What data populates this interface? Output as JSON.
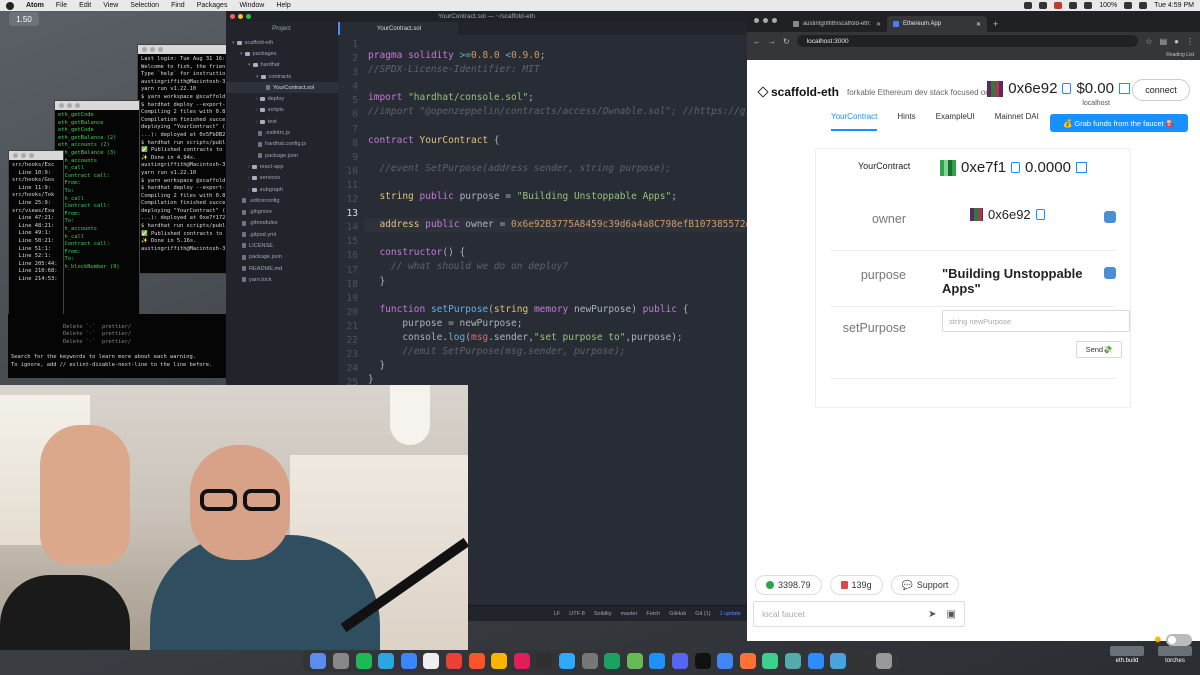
{
  "menubar": {
    "app": "Atom",
    "items": [
      "File",
      "Edit",
      "View",
      "Selection",
      "Find",
      "Packages",
      "Window",
      "Help"
    ],
    "battery": "100%",
    "clock": "Tue 4:59 PM"
  },
  "zoom_badge": "1.50",
  "terminals": {
    "t1": [
      "src/hooks/Exc",
      "  Line 10:9:",
      "",
      "src/hooks/Gos",
      "  Line 11:9:",
      "",
      "src/hooks/Tok",
      "  Line 25:9:",
      "",
      "src/views/Exa",
      "  Line 47:21:",
      "  Line 48:21:",
      "  Line 49:1:",
      "  Line 50:21:",
      "  Line 51:1:",
      "  Line 52:1:",
      "  Line 205:44:",
      "  Line 210:68:",
      "  Line 214:53:"
    ],
    "t2": [
      "eth_getCode",
      "eth_getBalance",
      "eth_getCode",
      "eth_getBalance (2)",
      "eth_accounts (2)",
      "eth_getBalance (3)",
      "eth_accounts",
      "eth_call",
      "  Contract call:",
      "  From:",
      "  To:",
      "",
      "eth_call",
      "  Contract call:",
      "  From:",
      "  To:",
      "",
      "eth_accounts",
      "eth_call",
      "  Contract call:",
      "  From:",
      "  To:",
      "",
      "eth_blockNumber (9)"
    ],
    "t3": [
      "Last login: Tue Aug 31 16:",
      "Welcome to fish, the frien",
      "Type `help` for instructio",
      "austingriffith@Macintosh-3",
      "yarn run v1.22.10",
      "$ yarn workspace @scaffold",
      "$ hardhat deploy --export-",
      "Compiling 2 files with 0.8",
      "Compilation finished succe",
      "deploying \"YourContract\" (",
      "...): deployed at 0x5FbDB2",
      "$ hardhat run scripts/publ",
      "✅ Published contracts to",
      "✨ Done in 4.94s.",
      "austingriffith@Macintosh-3",
      "yarn run v1.22.10",
      "$ yarn workspace @scaffold",
      "$ hardhat deploy --export-",
      "Compiling 2 files with 0.8",
      "Compilation finished succe",
      "deploying \"YourContract\" (",
      "...): deployed at 0xe7f172",
      "$ hardhat run scripts/publ",
      "✅ Published contracts to",
      "✨ Done in 5.16s.",
      "austingriffith@Macintosh-3"
    ],
    "main_lines": [
      "Delete `·`  prettier/",
      "Delete `·`  prettier/",
      "Delete `·`  prettier/"
    ],
    "footer1": "Search for the keywords to learn more about each warning.",
    "footer2": "To ignore, add // eslint-disable-next-line to the line before."
  },
  "atom": {
    "title": "YourContract.sol — ~/scaffold-eth",
    "project_tab": "Project",
    "file_tab": "YourContract.sol",
    "tree": [
      {
        "label": "scaffold-eth",
        "indent": 0,
        "type": "folder",
        "arrow": "▾"
      },
      {
        "label": "packages",
        "indent": 1,
        "type": "folder",
        "arrow": "▾"
      },
      {
        "label": "hardhat",
        "indent": 2,
        "type": "folder",
        "arrow": "▾"
      },
      {
        "label": "contracts",
        "indent": 3,
        "type": "folder",
        "arrow": "▾"
      },
      {
        "label": "YourContract.sol",
        "indent": 4,
        "type": "file",
        "arrow": "",
        "selected": true
      },
      {
        "label": "deploy",
        "indent": 3,
        "type": "folder",
        "arrow": "›"
      },
      {
        "label": "scripts",
        "indent": 3,
        "type": "folder",
        "arrow": "›"
      },
      {
        "label": "test",
        "indent": 3,
        "type": "folder",
        "arrow": "›"
      },
      {
        "label": ".eslintrc.js",
        "indent": 3,
        "type": "file",
        "arrow": ""
      },
      {
        "label": "hardhat.config.js",
        "indent": 3,
        "type": "file",
        "arrow": ""
      },
      {
        "label": "package.json",
        "indent": 3,
        "type": "file",
        "arrow": ""
      },
      {
        "label": "react-app",
        "indent": 2,
        "type": "folder",
        "arrow": "›"
      },
      {
        "label": "services",
        "indent": 2,
        "type": "folder",
        "arrow": "›"
      },
      {
        "label": "subgraph",
        "indent": 2,
        "type": "folder",
        "arrow": "›"
      },
      {
        "label": ".editorconfig",
        "indent": 1,
        "type": "file",
        "arrow": ""
      },
      {
        "label": ".gitignore",
        "indent": 1,
        "type": "file",
        "arrow": ""
      },
      {
        "label": ".gitmodules",
        "indent": 1,
        "type": "file",
        "arrow": ""
      },
      {
        "label": ".gitpod.yml",
        "indent": 1,
        "type": "file",
        "arrow": ""
      },
      {
        "label": "LICENSE",
        "indent": 1,
        "type": "file",
        "arrow": ""
      },
      {
        "label": "package.json",
        "indent": 1,
        "type": "file",
        "arrow": ""
      },
      {
        "label": "README.md",
        "indent": 1,
        "type": "file",
        "arrow": ""
      },
      {
        "label": "yarn.lock",
        "indent": 1,
        "type": "file",
        "arrow": ""
      }
    ],
    "current_line": 13,
    "status": [
      "LF",
      "UTF-8",
      "Solidity",
      "master",
      "Fetch",
      "GitHub",
      "Git (1)",
      "1 update"
    ]
  },
  "browser": {
    "tabs": [
      {
        "label": "austintgriffith/scaffold-eth: f",
        "active": false
      },
      {
        "label": "Ethereum App",
        "active": true
      }
    ],
    "url": "localhost:3000",
    "bookmarks": "Reading List",
    "app": {
      "logo": "scaffold-eth",
      "tagline": "forkable Ethereum dev stack focused on fast product iterations",
      "account_address": "0x6e92",
      "balance": "$0.00",
      "network": "localhost",
      "connect_label": "connect",
      "faucet_button": "💰 Grab funds from the faucet ⛽️",
      "nav": [
        {
          "label": "YourContract",
          "active": true
        },
        {
          "label": "Hints",
          "active": false
        },
        {
          "label": "ExampleUI",
          "active": false
        },
        {
          "label": "Mainnet DAI",
          "active": false
        }
      ],
      "contract": {
        "name": "YourContract",
        "address": "0xe7f1",
        "balance": "0.0000",
        "owner_label": "owner",
        "owner_value": "0x6e92",
        "purpose_label": "purpose",
        "purpose_value": "\"Building Unstoppable Apps\"",
        "setpurpose_label": "setPurpose",
        "setpurpose_placeholder": "string newPurpose",
        "send_label": "Send💸"
      },
      "footer": {
        "price": "3398.79",
        "gas": "139g",
        "support": "Support",
        "faucet_placeholder": "local faucet"
      }
    }
  },
  "dock_right": [
    "eth.build",
    "torches"
  ]
}
